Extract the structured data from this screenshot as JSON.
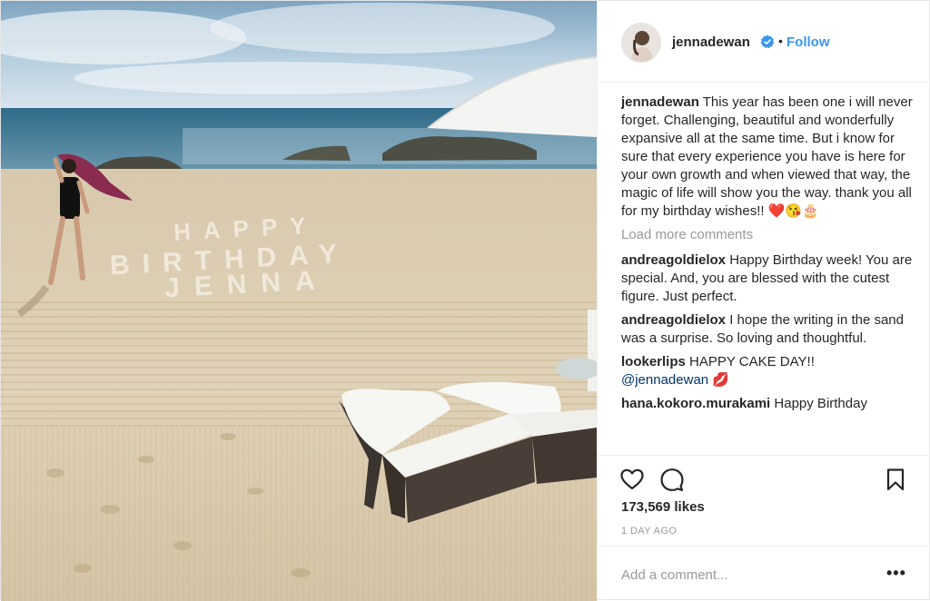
{
  "post": {
    "author": "jennadewan",
    "follow_label": "Follow",
    "separator": "•",
    "photo_text": [
      "HAPPY",
      "BIRTHDAY",
      "JENNA"
    ]
  },
  "comments": {
    "caption": {
      "user": "jennadewan",
      "text": "This year has been one i will never forget. Challenging, beautiful and wonderfully expansive all at the same time. But i know for sure that every experience you have is here for your own growth and when viewed that way, the magic of life will show you the way. thank you all for my birthday wishes!! ❤️😘🎂"
    },
    "load_more": "Load more comments",
    "items": [
      {
        "user": "andreagoldielox",
        "text": "Happy Birthday week! You are special. And, you are blessed with the cutest figure. Just perfect."
      },
      {
        "user": "andreagoldielox",
        "text": "I hope the writing in the sand was a surprise. So loving and thoughtful."
      },
      {
        "user": "lookerlips",
        "text": "HAPPY CAKE DAY!!",
        "mention": "@jennadewan",
        "emoji": "💋"
      },
      {
        "user": "hana.kokoro.murakami",
        "text": "Happy Birthday"
      }
    ]
  },
  "stats": {
    "likes": "173,569 likes",
    "time": "1 DAY AGO"
  },
  "composer": {
    "placeholder": "Add a comment...",
    "more_label": "•••"
  },
  "icons": {
    "like": "heart-outline-icon",
    "comment": "speech-bubble-icon",
    "save": "bookmark-icon",
    "verified": "verified-badge-icon"
  },
  "colors": {
    "link_blue": "#3897f0",
    "text": "#262626",
    "muted": "#999999",
    "border": "#efefef"
  }
}
